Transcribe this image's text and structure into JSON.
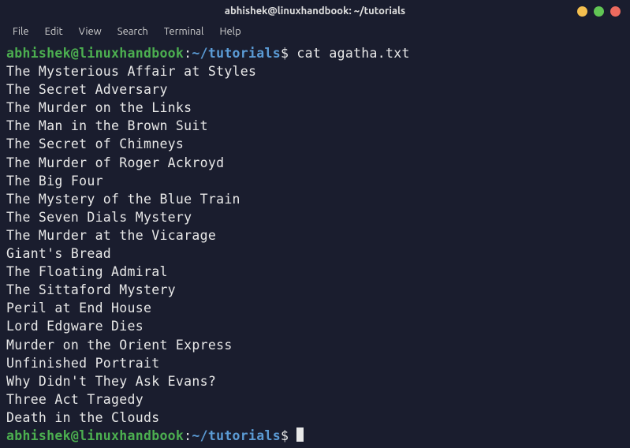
{
  "titlebar": {
    "title": "abhishek@linuxhandbook: ~/tutorials"
  },
  "menubar": {
    "items": [
      "File",
      "Edit",
      "View",
      "Search",
      "Terminal",
      "Help"
    ]
  },
  "terminal": {
    "prompt1": {
      "user_host": "abhishek@linuxhandbook",
      "colon": ":",
      "path": "~/tutorials",
      "dollar": "$",
      "command": " cat agatha.txt"
    },
    "output": [
      "The Mysterious Affair at Styles",
      "The Secret Adversary",
      "The Murder on the Links",
      "The Man in the Brown Suit",
      "The Secret of Chimneys",
      "The Murder of Roger Ackroyd",
      "The Big Four",
      "The Mystery of the Blue Train",
      "The Seven Dials Mystery",
      "The Murder at the Vicarage",
      "Giant's Bread",
      "The Floating Admiral",
      "The Sittaford Mystery",
      "Peril at End House",
      "Lord Edgware Dies",
      "Murder on the Orient Express",
      "Unfinished Portrait",
      "Why Didn't They Ask Evans?",
      "Three Act Tragedy",
      "Death in the Clouds"
    ],
    "prompt2": {
      "user_host": "abhishek@linuxhandbook",
      "colon": ":",
      "path": "~/tutorials",
      "dollar": "$",
      "command": " "
    }
  }
}
